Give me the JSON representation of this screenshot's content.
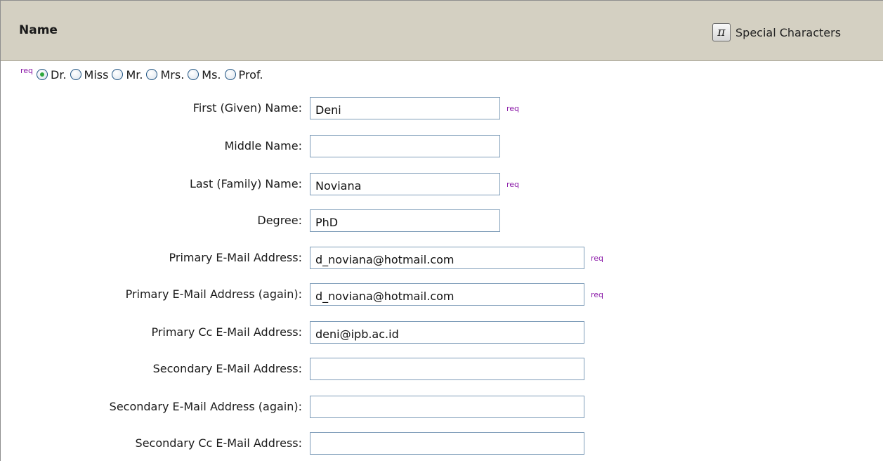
{
  "section": {
    "title": "Name",
    "special_characters_icon": "pi-icon",
    "special_characters_label": "Special Characters"
  },
  "req_label": "req",
  "salutation": {
    "selected": "Dr.",
    "options": [
      "Dr.",
      "Miss",
      "Mr.",
      "Mrs.",
      "Ms.",
      "Prof."
    ]
  },
  "fields": {
    "first_name": {
      "label": "First (Given) Name:",
      "value": "Deni",
      "required": true
    },
    "middle_name": {
      "label": "Middle Name:",
      "value": "",
      "required": false
    },
    "last_name": {
      "label": "Last (Family) Name:",
      "value": "Noviana",
      "required": true
    },
    "degree": {
      "label": "Degree:",
      "value": "PhD",
      "required": false
    },
    "primary_email": {
      "label": "Primary E-Mail Address:",
      "value": "d_noviana@hotmail.com",
      "required": true
    },
    "primary_email_again": {
      "label": "Primary E-Mail Address (again):",
      "value": "d_noviana@hotmail.com",
      "required": true
    },
    "primary_cc_email": {
      "label": "Primary Cc E-Mail Address:",
      "value": "deni@ipb.ac.id",
      "required": false
    },
    "secondary_email": {
      "label": "Secondary E-Mail Address:",
      "value": "",
      "required": false
    },
    "secondary_email_again": {
      "label": "Secondary E-Mail Address (again):",
      "value": "",
      "required": false
    },
    "secondary_cc_email": {
      "label": "Secondary Cc E-Mail Address:",
      "value": "",
      "required": false
    }
  },
  "colors": {
    "header_bg": "#d4d0c2",
    "req_color": "#8b1aa8",
    "input_border": "#7f9db9",
    "radio_border": "#1c5180",
    "radio_dot": "#2fa83d"
  }
}
